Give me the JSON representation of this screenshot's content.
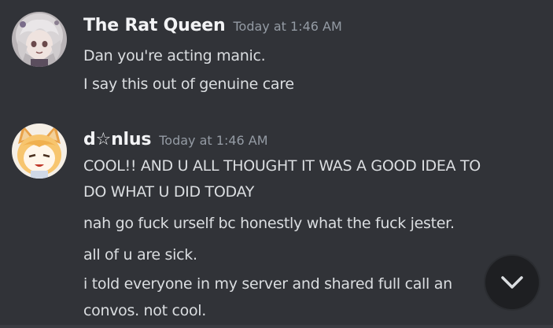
{
  "theme": {
    "background": "#313338",
    "username_color": "#f2f3f5",
    "timestamp_color": "#949ba4",
    "text_color": "#dbdee1",
    "scroll_button_bg": "#1e1f22"
  },
  "messages": [
    {
      "username": "The Rat Queen",
      "timestamp": "Today at 1:46 AM",
      "avatar_icon": "anime-girl-white-hair-avatar",
      "lines": [
        "Dan you're acting manic.",
        "I say this out of genuine care"
      ]
    },
    {
      "username": "d☆nlus",
      "timestamp": "Today at 1:46 AM",
      "avatar_icon": "anime-cat-ear-girl-avatar",
      "lines": [
        "COOL!! AND U ALL THOUGHT IT WAS A GOOD IDEA TO",
        "DO WHAT U DID TODAY",
        "nah go fuck urself bc honestly what the fuck jester.",
        "all of u are sick.",
        "i told everyone in my server and shared full call an",
        "convos. not cool."
      ]
    }
  ],
  "scroll_button": {
    "icon": "chevron-down-icon"
  }
}
